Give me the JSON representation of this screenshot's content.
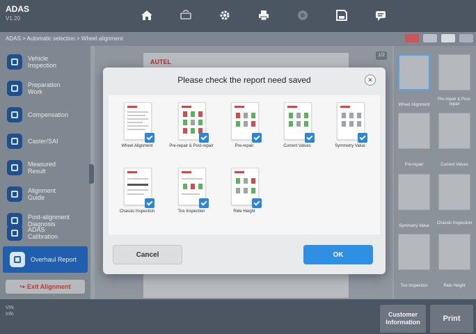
{
  "app": {
    "title": "ADAS",
    "version": "V1.20"
  },
  "toolbar": {
    "icons": [
      "home-icon",
      "vci-icon",
      "settings-icon",
      "print-icon",
      "help-icon",
      "save-icon",
      "feedback-icon"
    ]
  },
  "breadcrumb": {
    "text": "ADAS > Automatic selection > Wheel alignment"
  },
  "sidebar": {
    "items": [
      {
        "label": "Vehicle\nInspection",
        "icon": "vehicle-inspection-icon"
      },
      {
        "label": "Preparation\nWork",
        "icon": "preparation-icon"
      },
      {
        "label": "Compensation",
        "icon": "compensation-icon"
      },
      {
        "label": "Caster/SAI",
        "icon": "caster-icon"
      },
      {
        "label": "Measured\nResult",
        "icon": "measured-result-icon"
      },
      {
        "label": "Alignment\nGuide",
        "icon": "alignment-guide-icon"
      },
      {
        "label": "Post-alignment\nDiagnosis",
        "icon": "post-alignment-icon"
      },
      {
        "label": "ADAS\nCalibration",
        "icon": "adas-calibration-icon"
      },
      {
        "label": "Overhaul Report",
        "icon": "overhaul-report-icon"
      }
    ],
    "exit_label": "Exit Alignment"
  },
  "preview": {
    "logo": "AUTEL",
    "page_indicator": "1/2"
  },
  "thumbnails": [
    "Wheel Alignment",
    "Pre-repair & Post-repair",
    "Pre-repair",
    "Current Values",
    "Symmetry Value",
    "Chassis Inspection",
    "Tire Inspection",
    "Ride Height"
  ],
  "modal": {
    "title": "Please check the report need saved",
    "reports": [
      {
        "label": "Wheel Alignment",
        "checked": true
      },
      {
        "label": "Pre-repair & Post-repair",
        "checked": true
      },
      {
        "label": "Pre-repair",
        "checked": true
      },
      {
        "label": "Current Values",
        "checked": true
      },
      {
        "label": "Symmetry Value",
        "checked": true
      },
      {
        "label": "Chassis Inspection",
        "checked": true
      },
      {
        "label": "Tire Inspection",
        "checked": true
      },
      {
        "label": "Ride Height",
        "checked": true
      }
    ],
    "cancel_label": "Cancel",
    "ok_label": "OK"
  },
  "footer": {
    "vin_label": "VIN",
    "info_label": "Info",
    "customer_info_label": "Customer\nInformation",
    "print_label": "Print"
  },
  "colors": {
    "accent": "#2e8fe3",
    "active_nav": "#1f5fae",
    "exit_text": "#c0392b",
    "topbar": "#4c5663"
  }
}
